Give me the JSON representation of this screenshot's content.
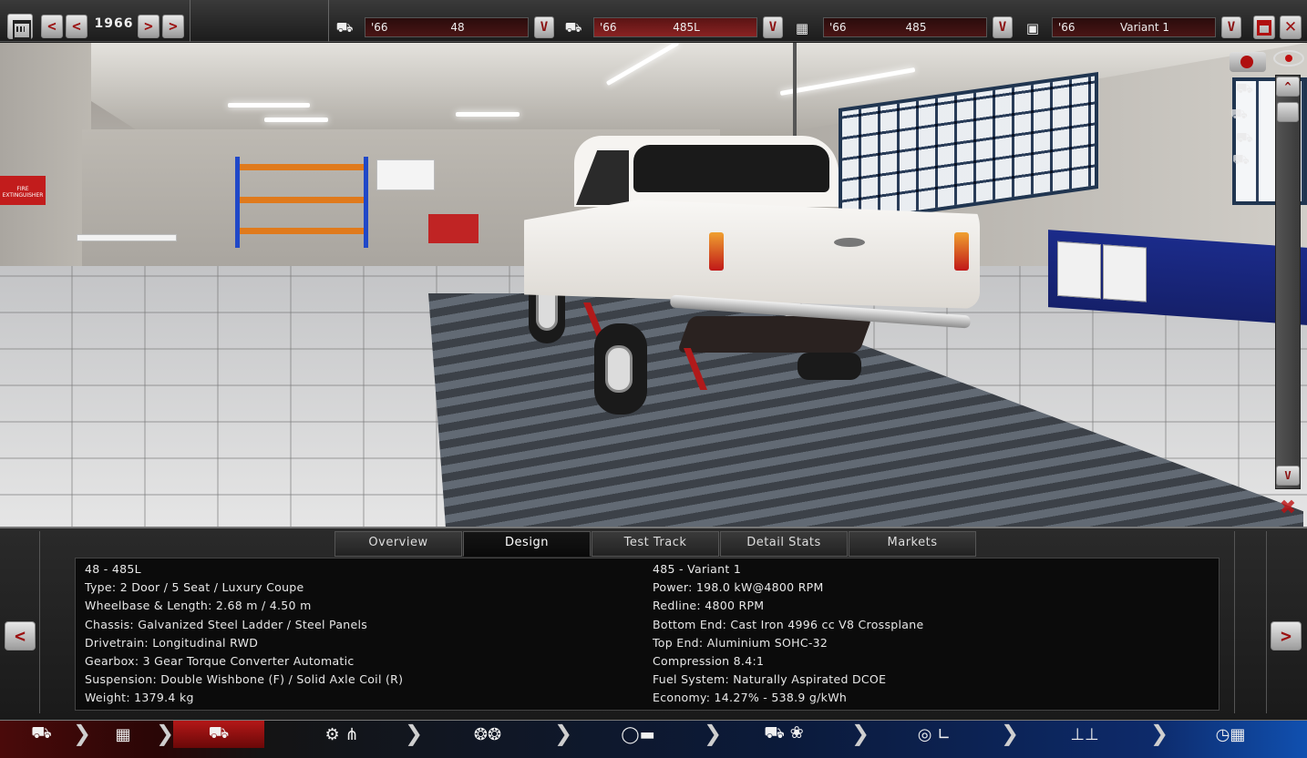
{
  "topbar": {
    "year": "1966",
    "prev_label": "<",
    "next_label": ">",
    "model": {
      "year": "'66",
      "name": "48"
    },
    "trim": {
      "year": "'66",
      "name": "485L"
    },
    "engine_family": {
      "year": "'66",
      "name": "485"
    },
    "engine_variant": {
      "year": "'66",
      "name": "Variant 1"
    },
    "dropdown_label": "V"
  },
  "viewport": {
    "scroll_up_label": "^",
    "scroll_down_label": "V",
    "sign_text": "FIRE EXTINGUISHER"
  },
  "tabs": [
    {
      "label": "Overview",
      "active": false
    },
    {
      "label": "Design",
      "active": true
    },
    {
      "label": "Test Track",
      "active": false
    },
    {
      "label": "Detail Stats",
      "active": false
    },
    {
      "label": "Markets",
      "active": false
    }
  ],
  "stats": {
    "left": [
      "48 - 485L",
      "Type: 2 Door / 5 Seat / Luxury Coupe",
      "Wheelbase & Length: 2.68 m / 4.50 m",
      "Chassis: Galvanized Steel Ladder / Steel Panels",
      "Drivetrain: Longitudinal RWD",
      "Gearbox: 3 Gear Torque Converter Automatic",
      "Suspension: Double Wishbone (F) / Solid Axle Coil (R)",
      "Weight: 1379.4 kg"
    ],
    "right": [
      "485 - Variant 1",
      "Power: 198.0 kW@4800 RPM",
      "Redline: 4800 RPM",
      "Bottom End: Cast Iron 4996 cc V8 Crossplane",
      "Top End: Aluminium SOHC-32",
      "Compression 8.4:1",
      "Fuel System: Naturally Aspirated DCOE",
      "Economy: 14.27% - 538.9 g/kWh"
    ]
  },
  "panel": {
    "prev_label": "<",
    "next_label": ">"
  },
  "bottom_nav": [
    {
      "icon": "car-model-icon"
    },
    {
      "icon": "chassis-icon"
    },
    {
      "icon": "trim-icon",
      "active": true
    },
    {
      "icon": "engine-gearbox-icon"
    },
    {
      "icon": "wheels-icon"
    },
    {
      "icon": "body-styling-icon"
    },
    {
      "icon": "interior-icon"
    },
    {
      "icon": "suspension-icon"
    },
    {
      "icon": "testing-icon"
    }
  ],
  "colors": {
    "accent": "#9b1010",
    "active_nav": "#b41818",
    "nav_blue": "#1050b0"
  }
}
